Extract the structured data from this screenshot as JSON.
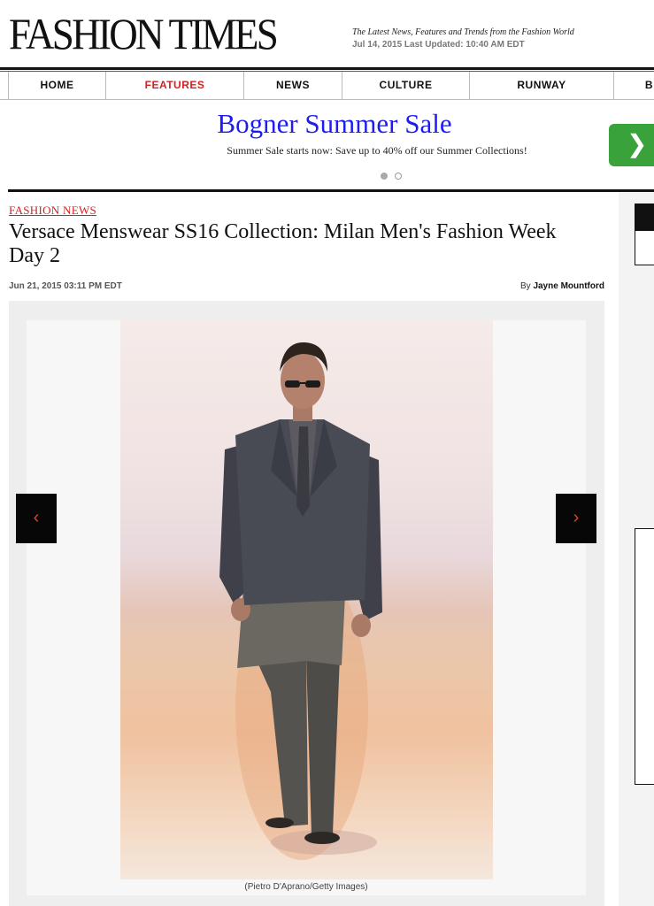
{
  "site": {
    "logo": "FASHION TIMES",
    "tagline": "The Latest News, Features and Trends from the Fashion World",
    "dateline": "Jul 14, 2015 Last Updated: 10:40 AM EDT"
  },
  "nav": {
    "items": [
      {
        "label": "HOME"
      },
      {
        "label": "FEATURES",
        "active": true
      },
      {
        "label": "NEWS"
      },
      {
        "label": "CULTURE"
      },
      {
        "label": "RUNWAY"
      },
      {
        "label": "B"
      }
    ],
    "active_color": "#d81e1e"
  },
  "ad": {
    "title": "Bogner Summer Sale",
    "text": "Summer Sale starts now: Save up to 40% off our Summer Collections!",
    "slides": 2,
    "active_slide": 1,
    "next_icon": "chevron-right-icon",
    "arrow_color": "#3aa23a",
    "title_color": "#1d1df0"
  },
  "article": {
    "category": "FASHION NEWS",
    "headline": "Versace Menswear SS16 Collection: Milan Men's Fashion Week Day 2",
    "date": "Jun 21, 2015 03:11 PM EDT",
    "byline_prefix": "By",
    "author": "Jayne Mountford"
  },
  "gallery": {
    "caption": "(Pietro D'Aprano/Getty Images)",
    "prev_icon": "chevron-left-icon",
    "next_icon": "chevron-right-icon",
    "arrow_color": "#d44830"
  }
}
